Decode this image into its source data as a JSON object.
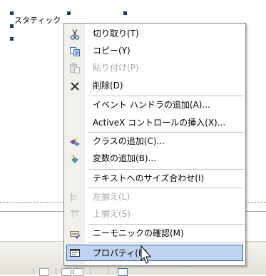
{
  "designer": {
    "static_label": "スタティック"
  },
  "context_menu": {
    "items": [
      {
        "label": "切り取り(T)",
        "icon": "scissors-icon",
        "enabled": true
      },
      {
        "label": "コピー(Y)",
        "icon": "copy-icon",
        "enabled": true
      },
      {
        "label": "貼り付け(P)",
        "icon": "paste-icon",
        "enabled": false
      },
      {
        "label": "削除(D)",
        "icon": "delete-x-icon",
        "enabled": true
      },
      {
        "label": "イベント ハンドラの追加(A)...",
        "icon": "",
        "enabled": true
      },
      {
        "label": "ActiveX コントロールの挿入(X)...",
        "icon": "",
        "enabled": true
      },
      {
        "label": "クラスの追加(C)...",
        "icon": "add-class-icon",
        "enabled": true
      },
      {
        "label": "変数の追加(B)...",
        "icon": "add-variable-icon",
        "enabled": true
      },
      {
        "label": "テキストへのサイズ合わせ(I)",
        "icon": "",
        "enabled": true
      },
      {
        "label": "左揃え(L)",
        "icon": "align-left-icon",
        "enabled": false
      },
      {
        "label": "上揃え(S)",
        "icon": "align-top-icon",
        "enabled": false
      },
      {
        "label": "ニーモニックの確認(M)",
        "icon": "check-mnemonics-icon",
        "enabled": true
      },
      {
        "label": "プロパティ(R)",
        "icon": "properties-icon",
        "enabled": true,
        "highlighted": true
      }
    ]
  },
  "colors": {
    "highlight_bg": "#c1d2ee",
    "highlight_border": "#316ac5",
    "disabled_text": "#a7a7a7",
    "icon_column": "#f1f0ec"
  }
}
